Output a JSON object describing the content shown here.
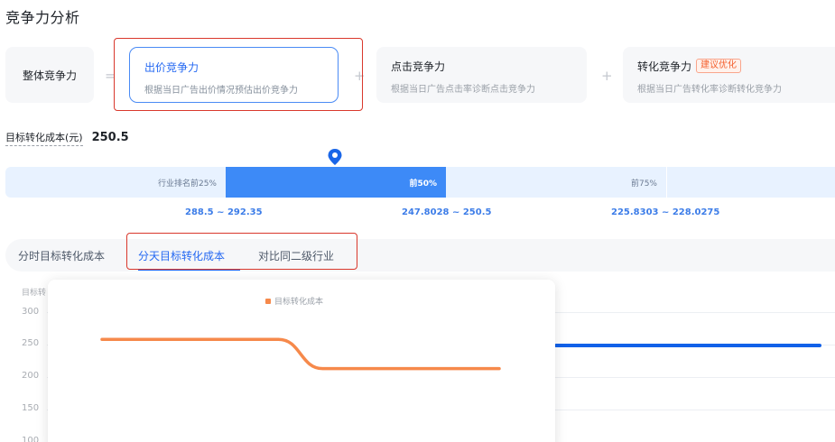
{
  "page": {
    "title": "竞争力分析"
  },
  "overall": {
    "label": "整体竞争力",
    "equals": "="
  },
  "operators": {
    "plus": "+"
  },
  "cards": [
    {
      "title": "出价竞争力",
      "desc": "根据当日广告出价情况预估出价竞争力",
      "active": true
    },
    {
      "title": "点击竞争力",
      "desc": "根据当日广告点击率诊断点击竞争力",
      "active": false
    },
    {
      "title": "转化竞争力",
      "badge": "建议优化",
      "desc": "根据当日广告转化率诊断转化竞争力",
      "active": false
    }
  ],
  "target": {
    "label": "目标转化成本(元)",
    "value": "250.5"
  },
  "ranking": {
    "segments": [
      "行业排名前25%",
      "前50%",
      "前75%"
    ],
    "ranges": [
      "288.5 ~ 292.35",
      "247.8028 ~ 250.5",
      "225.8303 ~ 228.0275"
    ],
    "active_index": 1
  },
  "tabs": {
    "group_label": "分时目标转化成本",
    "items": [
      "分天目标转化成本",
      "对比同二级行业"
    ],
    "selected": 0
  },
  "chart": {
    "ylabel_partial": "目标转",
    "y_ticks": [
      "300",
      "250",
      "200",
      "150",
      "100"
    ]
  },
  "tooltip": {
    "legend": "目标转化成本"
  },
  "colors": {
    "accent": "#2468f2",
    "rank_active": "#3d8af7",
    "series": "#f6894b",
    "highlight_box": "#d9382c",
    "badge": "#f4612f"
  },
  "chart_data": {
    "type": "line",
    "series": [
      {
        "name": "目标转化成本",
        "values": [
          258,
          258,
          258,
          258,
          258,
          213,
          213,
          213,
          213,
          213
        ]
      }
    ],
    "ylim": [
      100,
      300
    ],
    "title": "",
    "xlabel": "",
    "ylabel": "目标转"
  }
}
